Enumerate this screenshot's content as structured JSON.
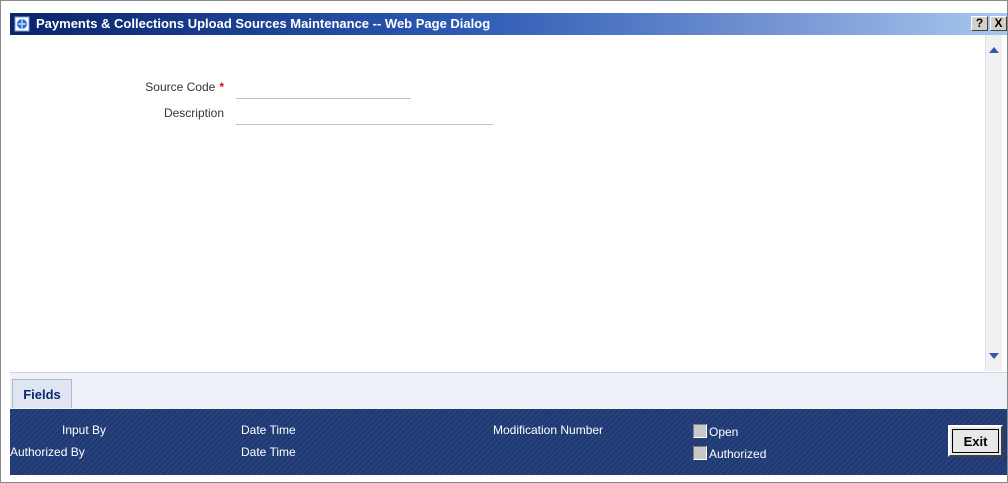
{
  "window": {
    "title": "Payments & Collections Upload Sources Maintenance -- Web Page Dialog",
    "help_label": "?",
    "close_label": "X"
  },
  "form": {
    "source_code": {
      "label": "Source Code",
      "required_mark": "*",
      "value": ""
    },
    "description": {
      "label": "Description",
      "value": ""
    }
  },
  "tabs": [
    {
      "label": "Fields"
    }
  ],
  "audit": {
    "input_by_label": "Input By",
    "authorized_by_label": "Authorized By",
    "date_time_label_1": "Date Time",
    "date_time_label_2": "Date Time",
    "modification_number_label": "Modification Number",
    "open_label": "Open",
    "authorized_label": "Authorized",
    "exit_label": "Exit"
  },
  "colors": {
    "titlebar": "#0a246a",
    "footer": "#203a75",
    "required": "#d01010"
  },
  "icons": {
    "title": "ie-page-icon",
    "scroll_up": "arrow-up-icon",
    "scroll_down": "arrow-down-icon"
  }
}
